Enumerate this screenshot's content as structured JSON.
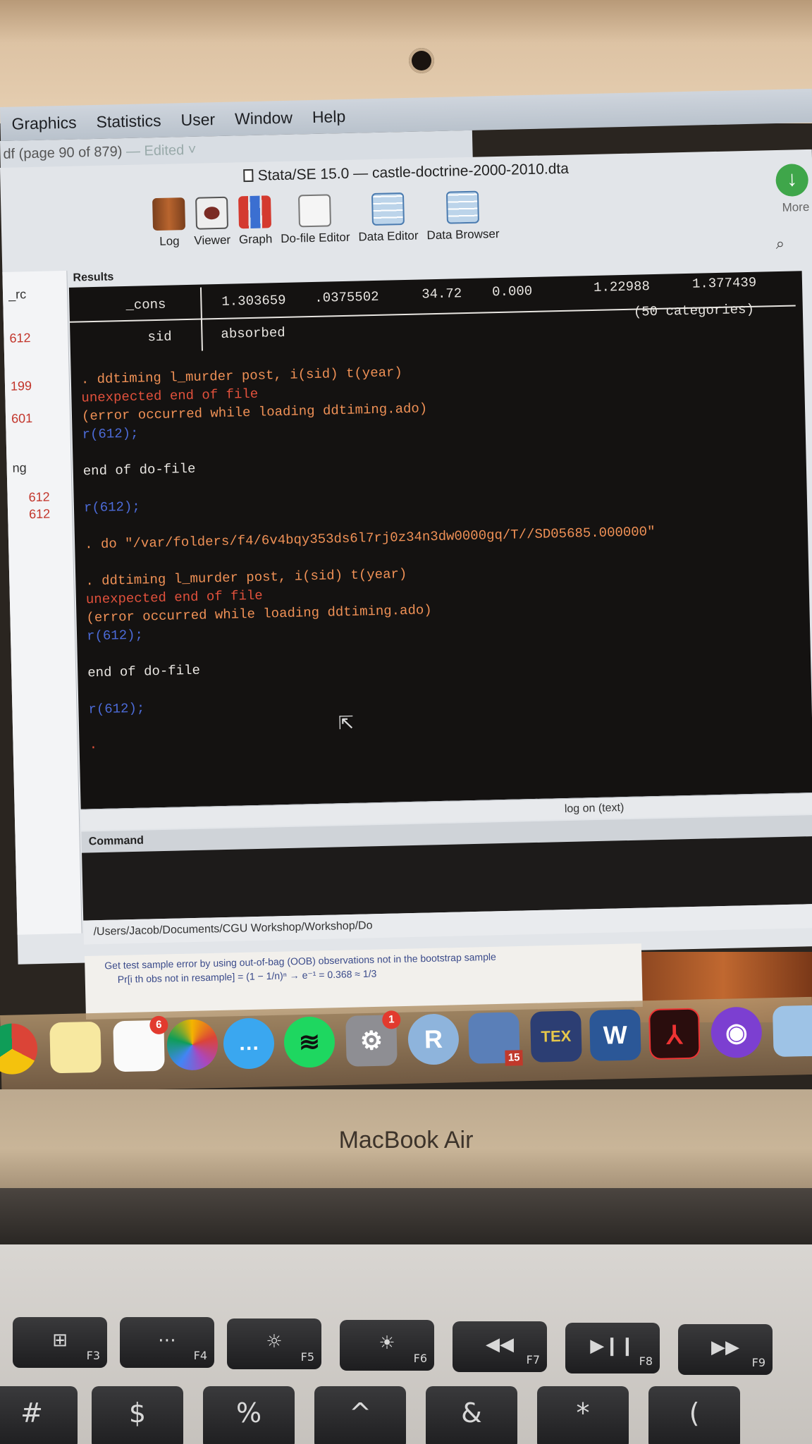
{
  "menubar": {
    "items": [
      "Graphics",
      "Statistics",
      "User",
      "Window",
      "Help"
    ]
  },
  "pdf_window": {
    "title": "df (page 90 of 879)",
    "edited": "— Edited ˅"
  },
  "stata": {
    "title": "Stata/SE 15.0 — castle-doctrine-2000-2010.dta",
    "toolbar": [
      "Log",
      "Viewer",
      "Graph",
      "Do-file Editor",
      "Data Editor",
      "Data Browser"
    ],
    "more_label": "More",
    "results_label": "Results",
    "left_panel": [
      "_rc",
      "612",
      "199",
      "601",
      "ng",
      "612",
      "612"
    ],
    "results": {
      "cons_row": [
        "_cons",
        "1.303659",
        ".0375502",
        "34.72",
        "0.000",
        "1.22988",
        "1.377439"
      ],
      "absorbed_row": [
        "sid",
        "absorbed",
        "(50 categories)"
      ],
      "lines": [
        ". ddtiming l_murder post, i(sid) t(year)",
        "unexpected end of file",
        "(error occurred while loading ddtiming.ado)",
        "r(612);",
        "end of do-file",
        "r(612);",
        ". do \"/var/folders/f4/6v4bqy353ds6l7rj0z34n3dw0000gq/T//SD05685.000000\"",
        ". ddtiming l_murder post, i(sid) t(year)",
        "unexpected end of file",
        "(error occurred while loading ddtiming.ado)",
        "r(612);",
        "end of do-file",
        "r(612);",
        "."
      ]
    },
    "status_text": "log on (text)",
    "command_label": "Command",
    "command_value": "",
    "path": "/Users/Jacob/Documents/CGU Workshop/Workshop/Do"
  },
  "slide": {
    "bullet1": "Get test sample error by using out-of-bag (OOB) observations not in the bootstrap sample",
    "bullet2": "Pr[i th obs not in resample] = (1 − 1/n)ⁿ → e⁻¹ = 0.368 ≈ 1/3"
  },
  "dock": {
    "reminders_badge": "6",
    "sysprefs_badge": "1",
    "stata_label": "15",
    "r_label": "R",
    "tex_label": "TEX",
    "word_label": "W"
  },
  "laptop": {
    "brand": "MacBook Air"
  },
  "keys": {
    "f3": "F3",
    "f4": "F4",
    "f5": "F5",
    "f6": "F6",
    "f7": "F7",
    "f8": "F8",
    "f9": "F9",
    "row2": [
      "#",
      "$",
      "%",
      "^",
      "&",
      "*",
      "("
    ]
  }
}
